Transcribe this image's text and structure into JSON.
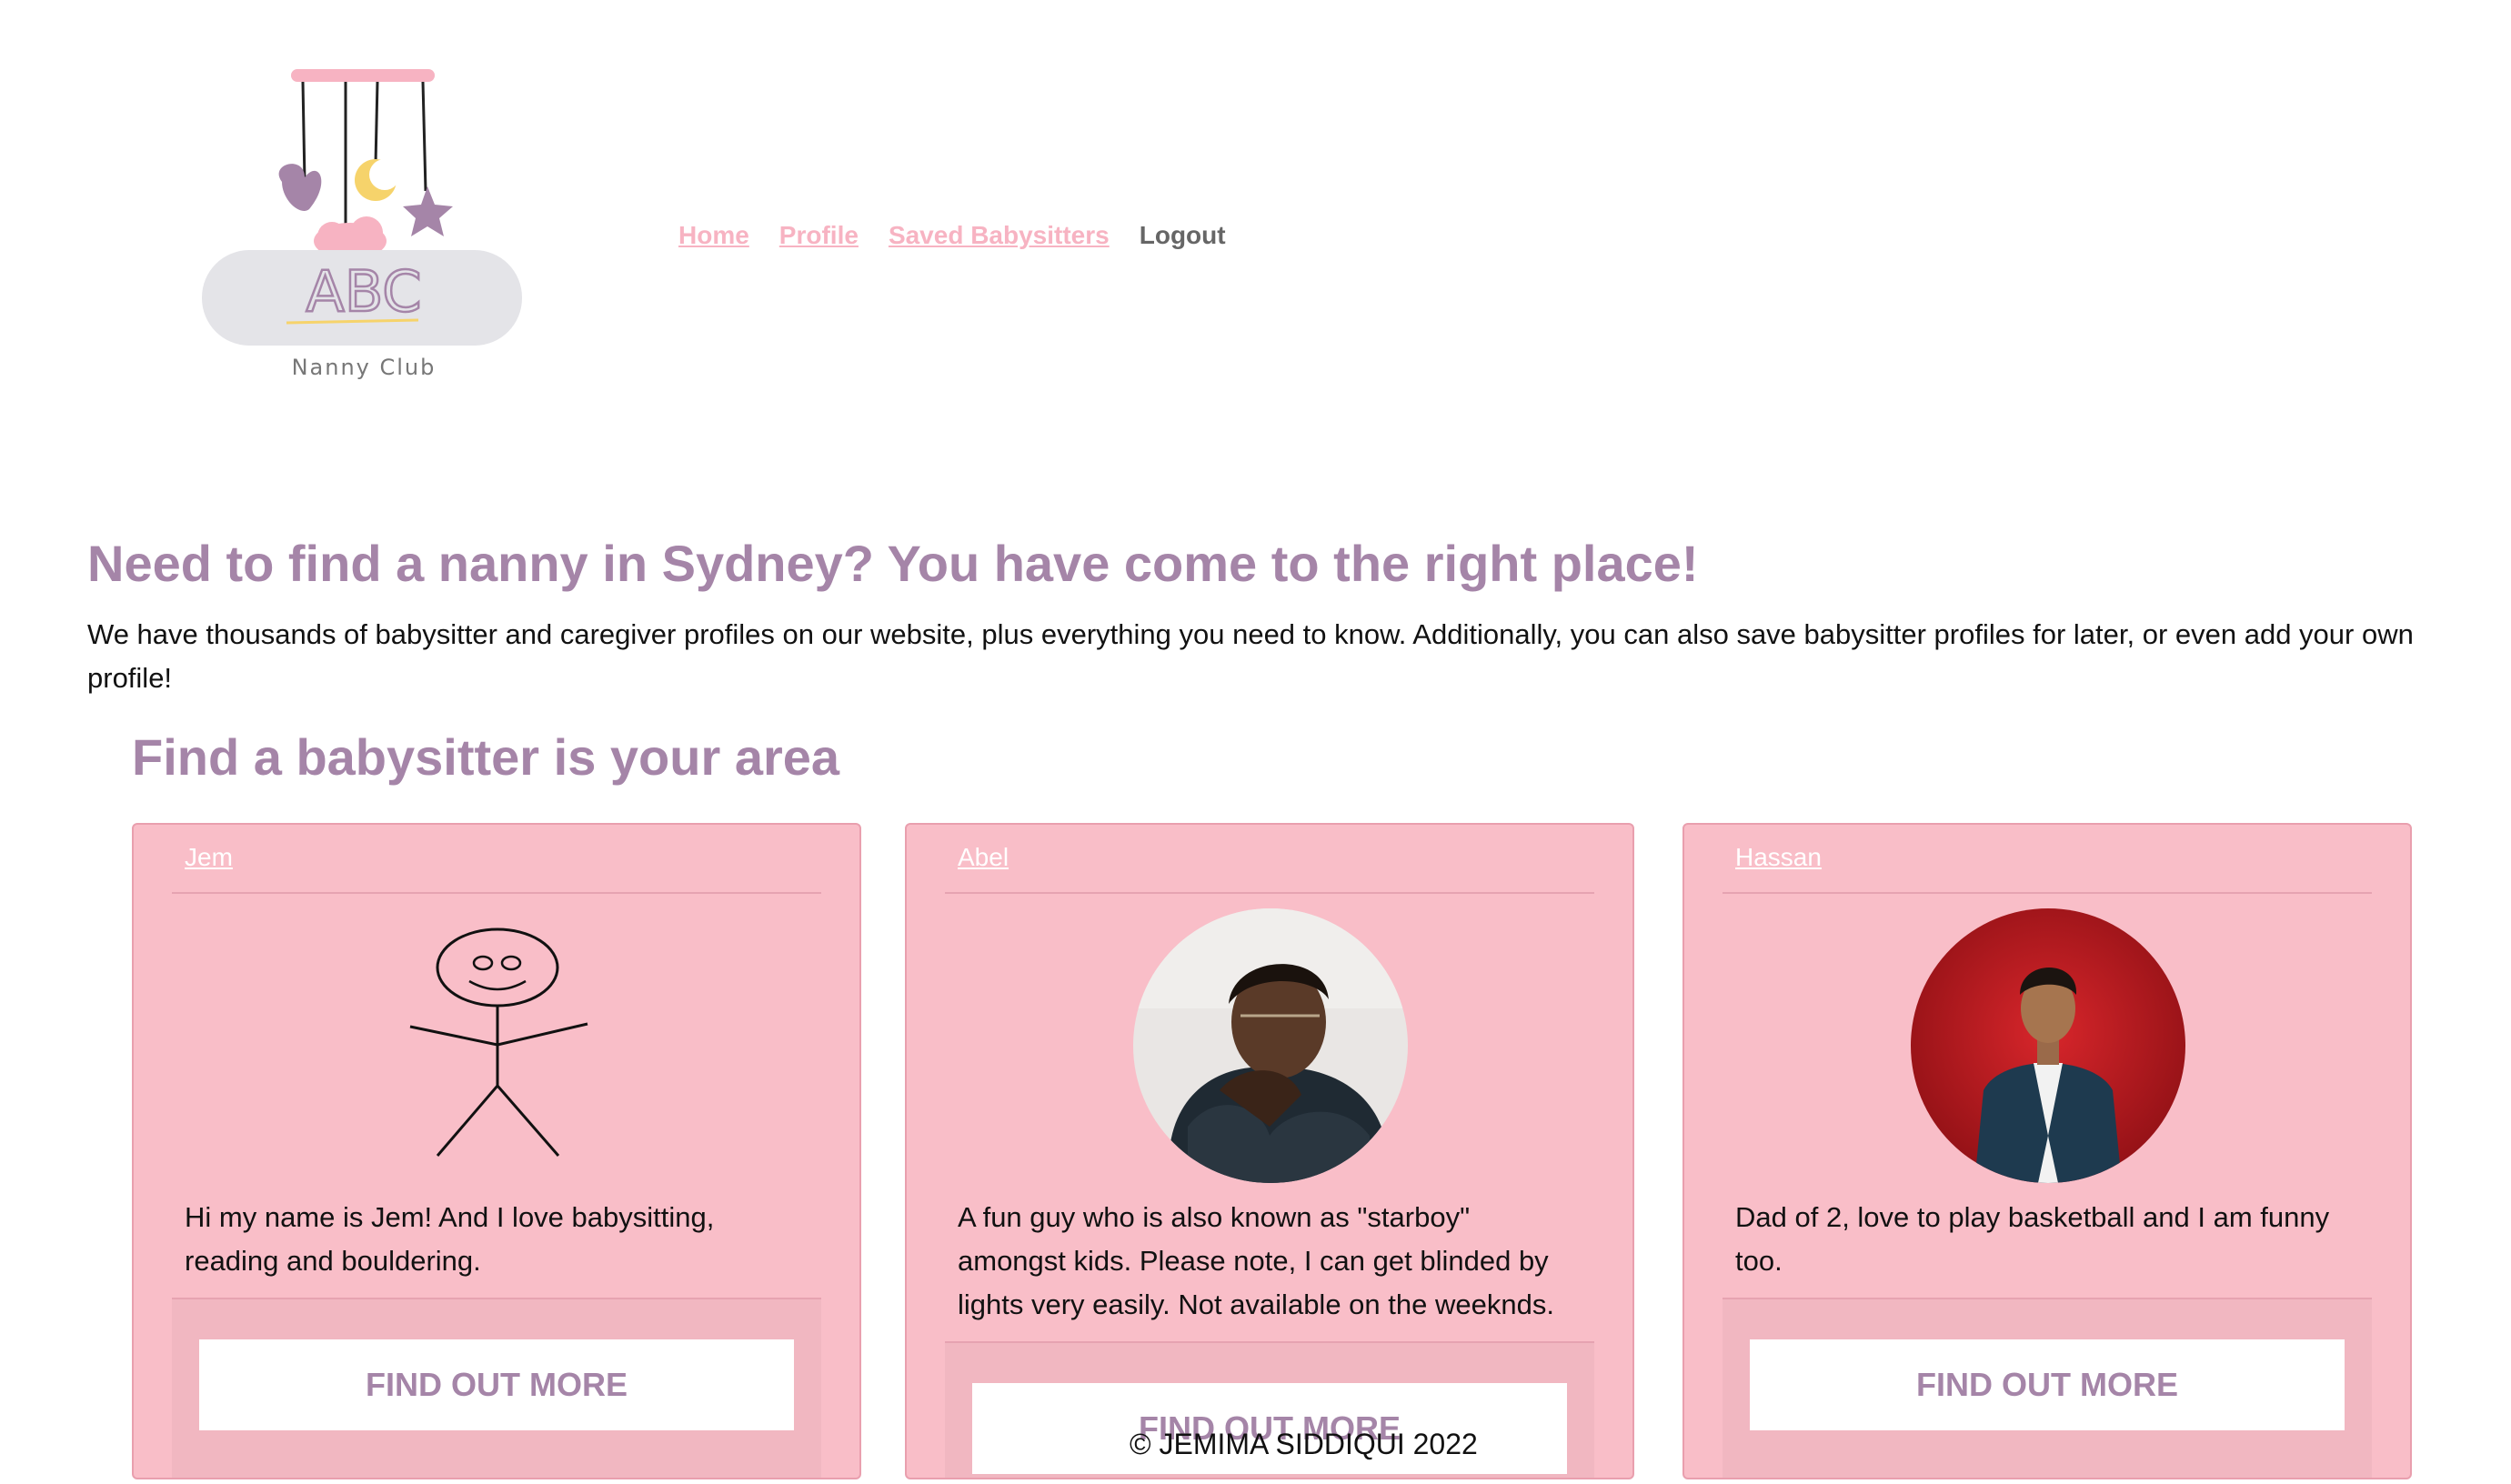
{
  "brand": {
    "logo_text": "ABC",
    "logo_sub": "Nanny Club"
  },
  "nav": {
    "home": "Home",
    "profile": "Profile",
    "saved": "Saved Babysitters",
    "logout": "Logout"
  },
  "hero": {
    "title": "Need to find a nanny in Sydney? You have come to the right place!",
    "text": "We have thousands of babysitter and caregiver profiles on our website, plus everything you need to know. Additionally, you can also save babysitter profiles for later, or even add your own profile!"
  },
  "section": {
    "title": "Find a babysitter is your area"
  },
  "cards": [
    {
      "name": "Jem",
      "bio": "Hi my name is Jem! And I love babysitting, reading and bouldering.",
      "button": "FIND OUT MORE"
    },
    {
      "name": "Abel",
      "bio": "A fun guy who is also known as \"starboy\" amongst kids. Please note, I can get blinded by lights very easily. Not available on the weeknds.",
      "button": "FIND OUT MORE"
    },
    {
      "name": "Hassan",
      "bio": "Dad of 2, love to play basketball and I am funny too.",
      "button": "FIND OUT MORE"
    }
  ],
  "footer": {
    "copyright": "© JEMIMA SIDDIQUI 2022"
  },
  "colors": {
    "accent": "#a585a8",
    "pink": "#f9bec8",
    "nav_link": "#f7b3c2"
  }
}
